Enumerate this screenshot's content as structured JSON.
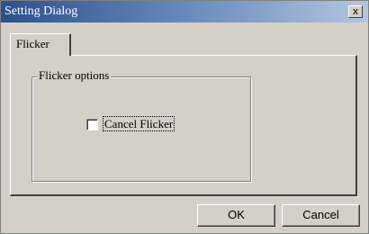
{
  "window": {
    "title": "Setting Dialog",
    "close_glyph": "x",
    "close_icon": "close-icon"
  },
  "tabs": [
    {
      "label": "Flicker",
      "selected": true
    }
  ],
  "group": {
    "label": "Flicker options"
  },
  "checkbox": {
    "label": "Cancel Flicker",
    "checked": false
  },
  "buttons": {
    "ok_label": "OK",
    "cancel_label": "Cancel"
  },
  "colors": {
    "title_bar_start": "#2d4f8f",
    "title_bar_end": "#b4c6df",
    "dialog_face": "#d4d0c8"
  }
}
